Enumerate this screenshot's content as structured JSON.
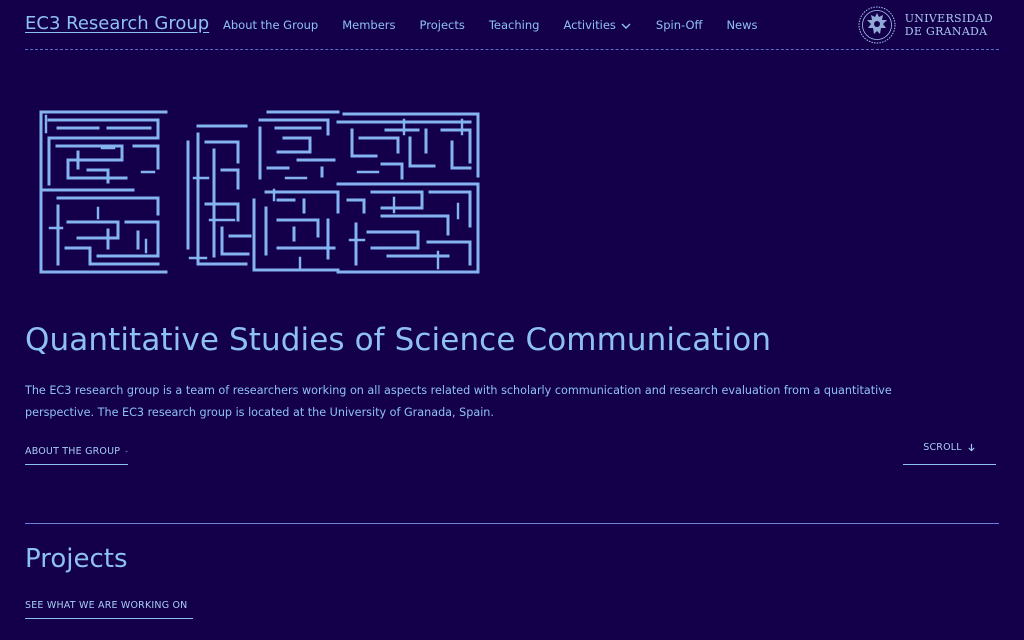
{
  "header": {
    "brand": "EC3 Research Group",
    "nav": [
      {
        "label": "About the Group"
      },
      {
        "label": "Members"
      },
      {
        "label": "Projects"
      },
      {
        "label": "Teaching"
      },
      {
        "label": "Activities",
        "has_dropdown": true
      },
      {
        "label": "Spin-Off"
      },
      {
        "label": "News"
      }
    ],
    "university": {
      "line1": "UNIVERSIDAD",
      "line2": "DE GRANADA",
      "seal_icon": "university-seal-icon"
    }
  },
  "hero": {
    "logo_text": "EC3",
    "title": "Quantitative Studies of Science Communication",
    "description": "The EC3 research group is a team of researchers working on all aspects related with scholarly communication and research evaluation from a quantitative perspective. The EC3 research group is located at the University of Granada, Spain.",
    "about_link": "ABOUT THE GROUP",
    "scroll_link": "SCROLL"
  },
  "projects": {
    "title": "Projects",
    "link": "SEE WHAT WE ARE WORKING ON"
  },
  "colors": {
    "background": "#14004a",
    "accent": "#8ec1f2",
    "logo_maze": "#84b4f0"
  }
}
